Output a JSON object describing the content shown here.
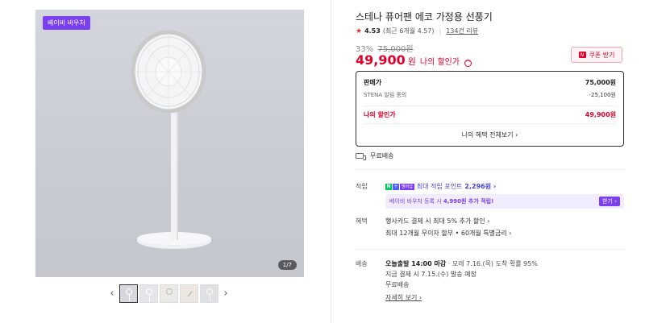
{
  "gallery": {
    "badge": "베이비 바우처",
    "counter": "1/7",
    "prev_icon": "‹",
    "next_icon": "›"
  },
  "product": {
    "title": "스테나 퓨어팬 에코 가정용 선풍기",
    "rating": "4.53",
    "rating_detail": "(최근 6개월 4.57)",
    "review_count": "134건 리뷰",
    "discount_rate": "33%",
    "original_price": "75,000원",
    "sale_price": "49,900",
    "price_unit": "원",
    "sale_label": "나의 할인가",
    "caret": "^",
    "coupon_label": "쿠폰 받기",
    "coupon_icon": "N"
  },
  "price_box": {
    "row1_label": "판매가",
    "row1_value": "75,000원",
    "row2_label": "STENA 알림 동의",
    "row2_value": "-25,100원",
    "row3_label": "나의 할인가",
    "row3_value": "49,900원",
    "more": "나의 혜택 전체보기 ›"
  },
  "shipping_free": "무료배송",
  "points": {
    "label": "적립",
    "npay_n": "N",
    "npay_p": "+",
    "npay_m": "멤버십",
    "text": "최대 적립 포인트",
    "amount": "2,296원 ›"
  },
  "voucher": {
    "text_prefix": "베이비 바우처 등록 시",
    "text_amount": "4,990원 추가 적립!",
    "button": "받기 ›"
  },
  "benefits": {
    "label": "혜택",
    "line1": "행사카드 결제 시 최대 5% 추가 할인 ›",
    "line2": "최대 12개월 무이자 할부 • 60개월 특별금리 ›"
  },
  "delivery": {
    "label": "배송",
    "bold": "오늘출발 14:00 마감",
    "detail": "· 모레 7.16.(목) 도착 확률 95%",
    "line2": "지금 결제 시 7.15.(수) 발송 예정",
    "line3": "무료배송",
    "more": "자세히 보기 ›"
  },
  "colors": {
    "accent_red": "#e4002b",
    "voucher_purple": "#7b3ff2",
    "npay_green": "#03c75a"
  }
}
